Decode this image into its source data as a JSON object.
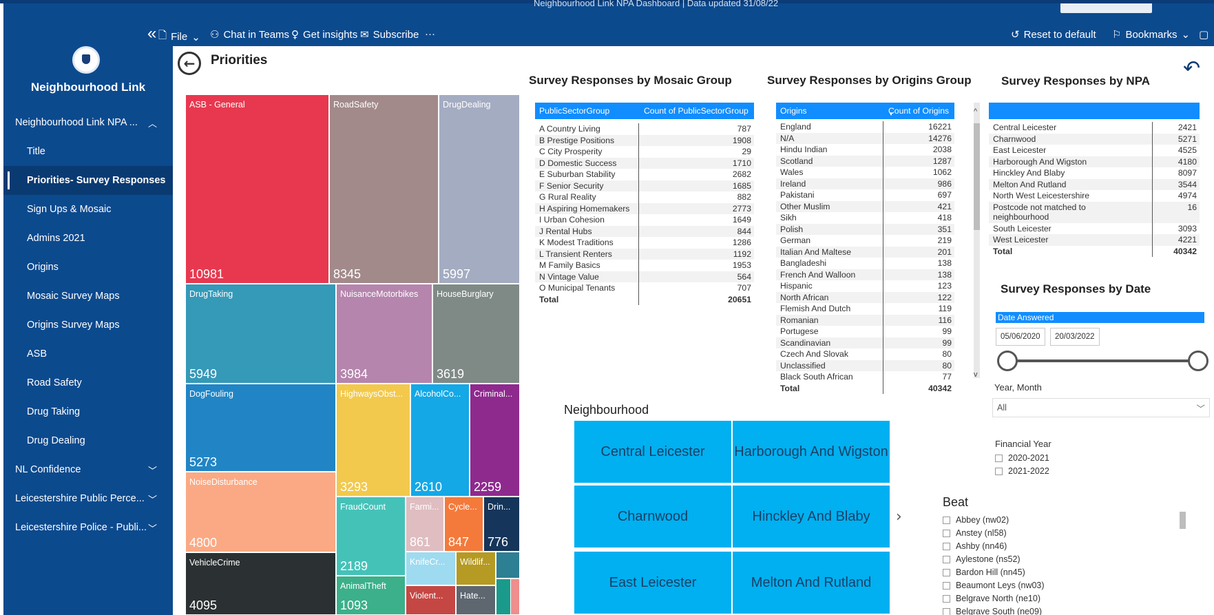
{
  "app": {
    "report_title": "Neighbourhood Link NPA Dashboard | Data updated 31/08/22"
  },
  "toolbar": {
    "collapse_glyph": "«",
    "file": "File",
    "chat": "Chat in Teams",
    "insights": "Get insights",
    "subscribe": "Subscribe",
    "more": "···",
    "reset": "Reset to default",
    "bookmarks": "Bookmarks"
  },
  "sidebar": {
    "title": "Neighbourhood Link",
    "items": [
      {
        "label": "Neighbourhood Link NPA ...",
        "chev": "︿"
      },
      {
        "label": "Title"
      },
      {
        "label": "Priorities- Survey Responses"
      },
      {
        "label": "Sign Ups & Mosaic"
      },
      {
        "label": "Admins 2021"
      },
      {
        "label": "Origins"
      },
      {
        "label": "Mosaic Survey Maps"
      },
      {
        "label": "Origins Survey Maps"
      },
      {
        "label": "ASB"
      },
      {
        "label": "Road Safety"
      },
      {
        "label": "Drug Taking"
      },
      {
        "label": "Drug Dealing"
      },
      {
        "label": "NL Confidence",
        "chev": "﹀"
      },
      {
        "label": "Leicestershire Public Perce...",
        "chev": "﹀"
      },
      {
        "label": "Leicestershire Police - Publi...",
        "chev": "﹀"
      }
    ]
  },
  "page": {
    "title": "Priorities",
    "back_glyph": "←",
    "undo_glyph": "↶"
  },
  "treemap": {
    "cells": [
      {
        "label": "ASB - General",
        "value": "10981",
        "color": "#e8384f"
      },
      {
        "label": "RoadSafety",
        "value": "8345",
        "color": "#a38a8a"
      },
      {
        "label": "DrugDealing",
        "value": "5997",
        "color": "#a4acc2"
      },
      {
        "label": "DrugTaking",
        "value": "5949",
        "color": "#3599b8"
      },
      {
        "label": "NuisanceMotorbikes",
        "value": "3984",
        "color": "#b585ad"
      },
      {
        "label": "HouseBurglary",
        "value": "3619",
        "color": "#7f8a87"
      },
      {
        "label": "DogFouling",
        "value": "5273",
        "color": "#2185c5"
      },
      {
        "label": "HighwaysObst...",
        "value": "3293",
        "color": "#f2c94c"
      },
      {
        "label": "AlcoholCo...",
        "value": "2610",
        "color": "#14a8e6"
      },
      {
        "label": "Criminal...",
        "value": "2259",
        "color": "#8e2a8e"
      },
      {
        "label": "NoiseDisturbance",
        "value": "4800",
        "color": "#fba984"
      },
      {
        "label": "FraudCount",
        "value": "2189",
        "color": "#45c2b8"
      },
      {
        "label": "Farmi...",
        "value": "861",
        "color": "#dfbdc1"
      },
      {
        "label": "Cycle...",
        "value": "847",
        "color": "#f47a3c"
      },
      {
        "label": "Drin...",
        "value": "776",
        "color": "#15355a"
      },
      {
        "label": "VehicleCrime",
        "value": "4095",
        "color": "#2b3132"
      },
      {
        "label": "KnifeCr...",
        "value": "",
        "color": "#9edbf0"
      },
      {
        "label": "Wildlif...",
        "value": "",
        "color": "#b59a23"
      },
      {
        "label": "",
        "value": "",
        "color": "#2d7f93"
      },
      {
        "label": "AnimalTheft",
        "value": "1093",
        "color": "#3bb08a"
      },
      {
        "label": "Violent...",
        "value": "",
        "color": "#c54744"
      },
      {
        "label": "Hate...",
        "value": "",
        "color": "#5e6770"
      },
      {
        "label": "",
        "value": "",
        "color": "#1a9a8b"
      },
      {
        "label": "",
        "value": "",
        "color": "#f08d8d"
      }
    ]
  },
  "mosaic": {
    "title": "Survey Responses by Mosaic Group",
    "col1": "PublicSectorGroup",
    "col2": "Count of PublicSectorGroup",
    "rows": [
      [
        "A Country Living",
        "787"
      ],
      [
        "B Prestige Positions",
        "1908"
      ],
      [
        "C City Prosperity",
        "29"
      ],
      [
        "D Domestic Success",
        "1710"
      ],
      [
        "E Suburban Stability",
        "2682"
      ],
      [
        "F Senior Security",
        "1685"
      ],
      [
        "G Rural Reality",
        "882"
      ],
      [
        "H Aspiring Homemakers",
        "2773"
      ],
      [
        "I Urban Cohesion",
        "1649"
      ],
      [
        "J Rental Hubs",
        "844"
      ],
      [
        "K Modest Traditions",
        "1286"
      ],
      [
        "L Transient Renters",
        "1192"
      ],
      [
        "M Family Basics",
        "1953"
      ],
      [
        "N Vintage Value",
        "564"
      ],
      [
        "O Municipal Tenants",
        "707"
      ]
    ],
    "total_label": "Total",
    "total_value": "20651"
  },
  "origins": {
    "title": "Survey Responses by Origins Group",
    "col1": "Origins",
    "col2": "Count of Origins",
    "sort_glyph": "▼",
    "rows": [
      [
        "England",
        "16221"
      ],
      [
        "N/A",
        "14276"
      ],
      [
        "Hindu Indian",
        "2038"
      ],
      [
        "Scotland",
        "1287"
      ],
      [
        "Wales",
        "1062"
      ],
      [
        "Ireland",
        "986"
      ],
      [
        "Pakistani",
        "697"
      ],
      [
        "Other Muslim",
        "421"
      ],
      [
        "Sikh",
        "418"
      ],
      [
        "Polish",
        "351"
      ],
      [
        "German",
        "219"
      ],
      [
        "Italian And Maltese",
        "201"
      ],
      [
        "Bangladeshi",
        "138"
      ],
      [
        "French And Walloon",
        "138"
      ],
      [
        "Hispanic",
        "123"
      ],
      [
        "North African",
        "122"
      ],
      [
        "Flemish And Dutch",
        "119"
      ],
      [
        "Romanian",
        "116"
      ],
      [
        "Portugese",
        "99"
      ],
      [
        "Scandinavian",
        "99"
      ],
      [
        "Czech And Slovak",
        "80"
      ],
      [
        "Unclassified",
        "80"
      ],
      [
        "Black South African",
        "77"
      ]
    ],
    "total_label": "Total",
    "total_value": "40342",
    "scroll_up": "^",
    "scroll_down": "v"
  },
  "npa": {
    "title": "Survey Responses by NPA",
    "rows": [
      [
        "Central Leicester",
        "2421"
      ],
      [
        "Charnwood",
        "5271"
      ],
      [
        "East Leicester",
        "4525"
      ],
      [
        "Harborough And Wigston",
        "4180"
      ],
      [
        "Hinckley And Blaby",
        "8097"
      ],
      [
        "Melton And Rutland",
        "3544"
      ],
      [
        "North West Leicestershire",
        "4974"
      ],
      [
        "Postcode not matched to neighbourhood",
        "16"
      ],
      [
        "South Leicester",
        "3093"
      ],
      [
        "West Leicester",
        "4221"
      ]
    ],
    "total_label": "Total",
    "total_value": "40342"
  },
  "date_slicer": {
    "title": "Survey Responses by Date",
    "header": "Date Answered",
    "start": "05/06/2020",
    "end": "20/03/2022"
  },
  "year_month": {
    "label": "Year, Month",
    "value": "All",
    "chev": "﹀"
  },
  "financial_year": {
    "label": "Financial Year",
    "options": [
      "2020-2021",
      "2021-2022"
    ]
  },
  "neighbourhood": {
    "title": "Neighbourhood",
    "tiles": [
      "Central Leicester",
      "Harborough And Wigston",
      "Charnwood",
      "Hinckley And Blaby",
      "East Leicester",
      "Melton And Rutland"
    ],
    "next_glyph": "›"
  },
  "beat": {
    "title": "Beat",
    "options": [
      "Abbey (nw02)",
      "Anstey (nl58)",
      "Ashby (nn46)",
      "Aylestone (ns52)",
      "Bardon Hill (nn45)",
      "Beaumont Leys (nw03)",
      "Belgrave North (ne10)",
      "Belgrave South (ne09)"
    ]
  },
  "colors": {
    "nav_bg": "#0c4a8e",
    "accent": "#118dff",
    "tile": "#00b0f0"
  }
}
